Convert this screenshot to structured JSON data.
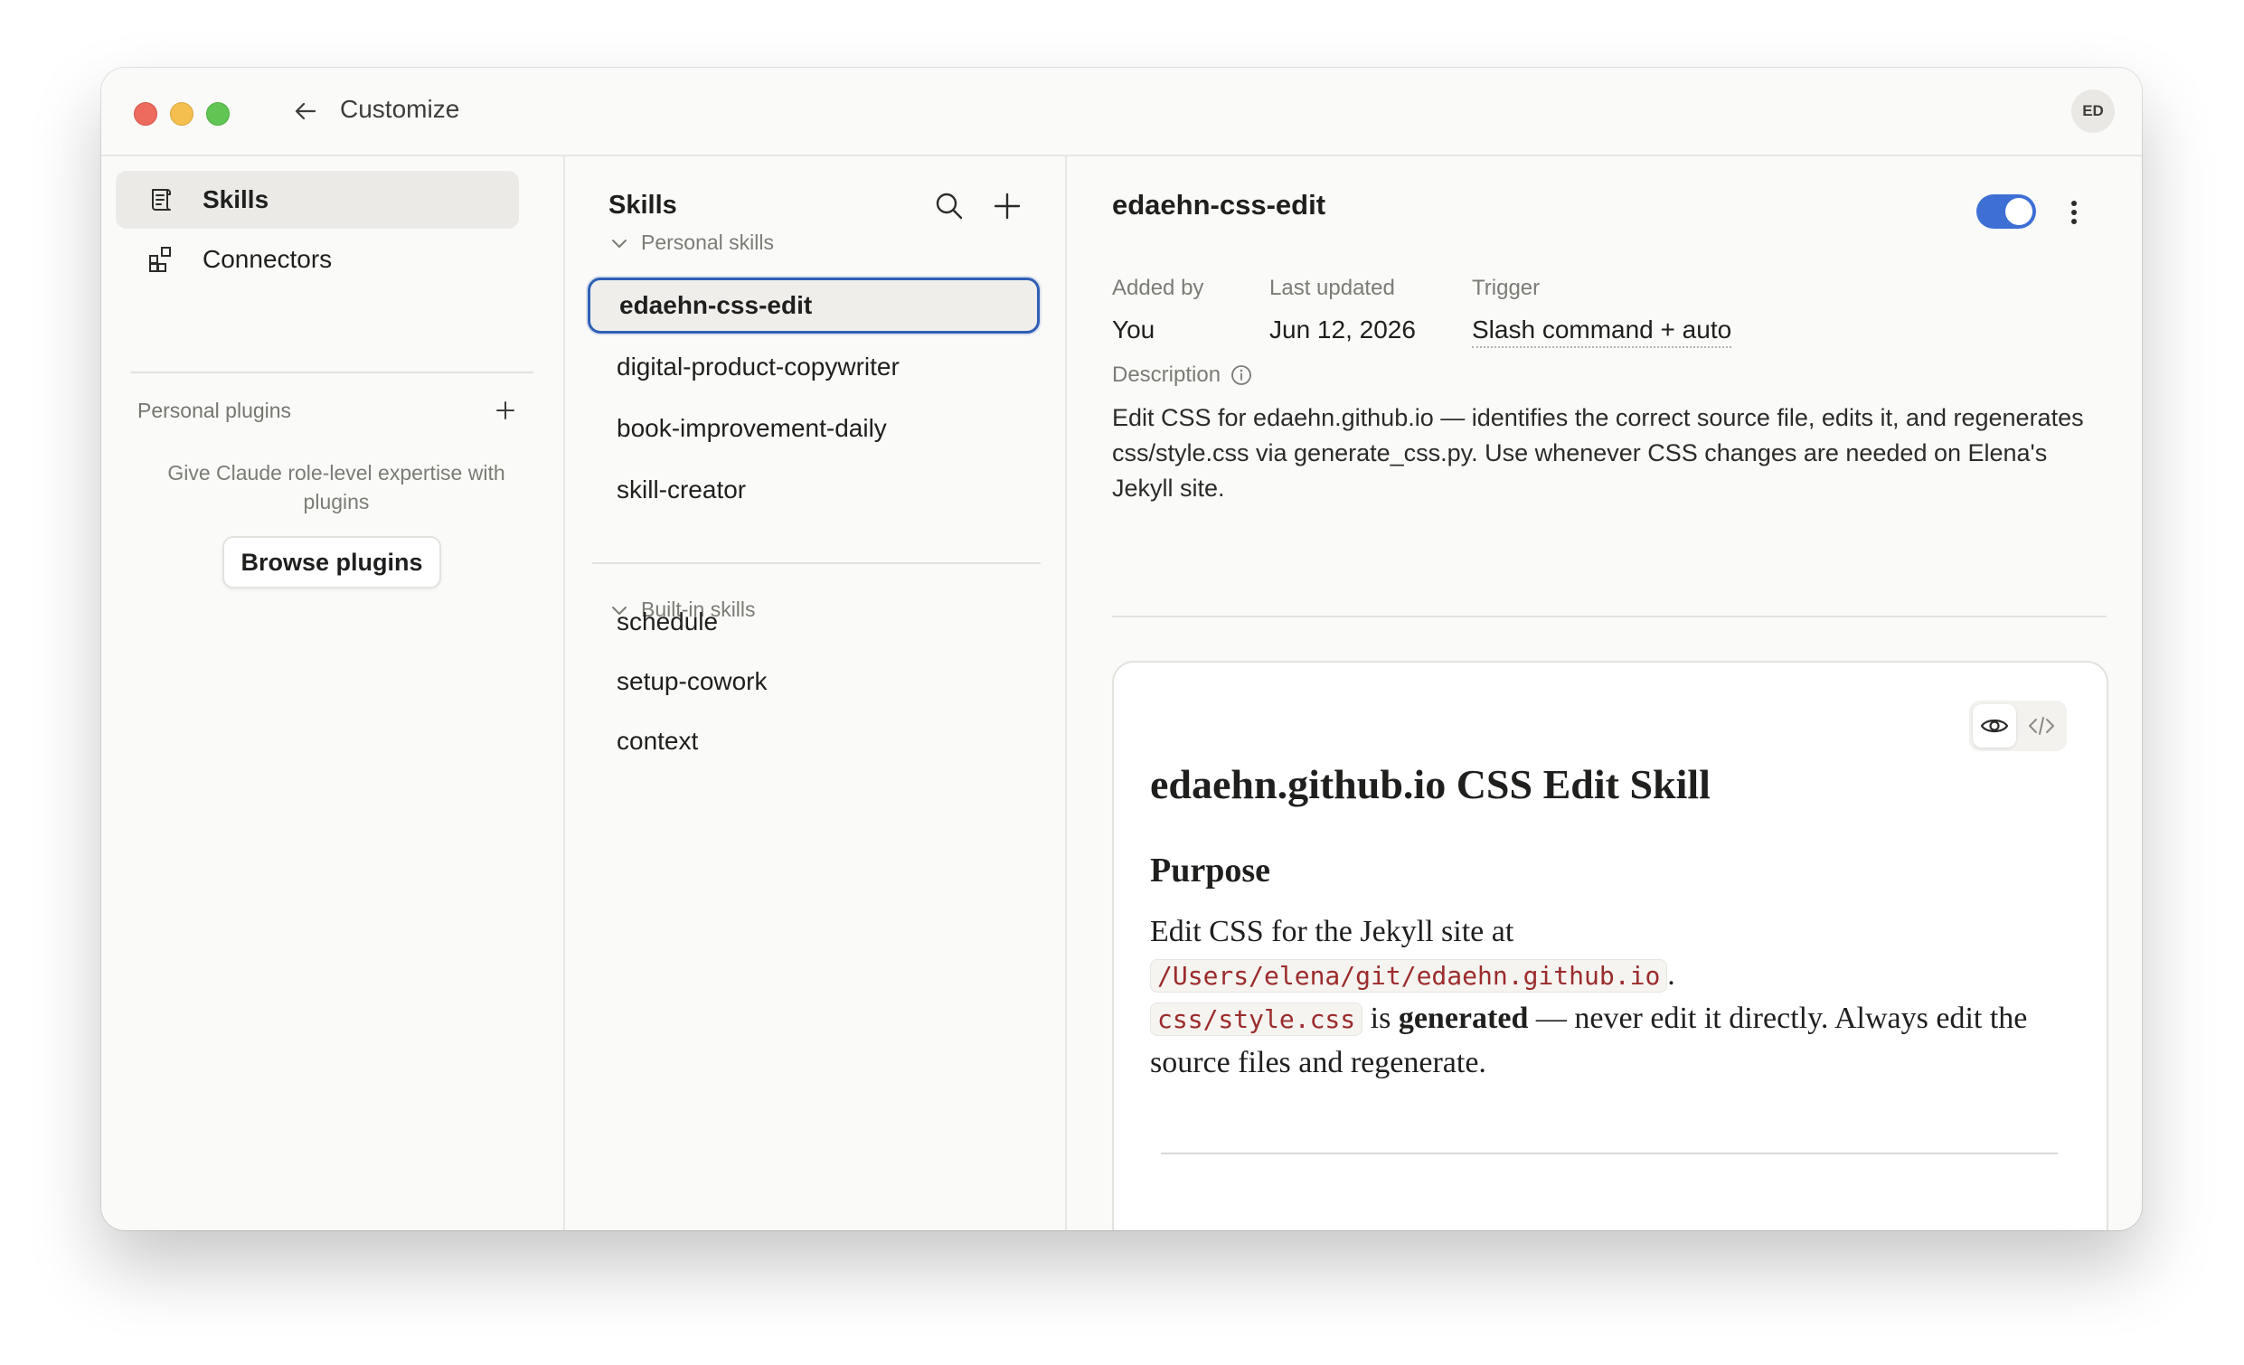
{
  "window": {
    "title": "Customize",
    "avatar_initials": "ED"
  },
  "nav": {
    "items": [
      {
        "label": "Skills",
        "icon": "scroll-icon",
        "active": true
      },
      {
        "label": "Connectors",
        "icon": "connectors-icon",
        "active": false
      }
    ],
    "plugins_heading": "Personal plugins",
    "plugins_hint": "Give Claude role-level expertise with plugins",
    "browse_label": "Browse plugins"
  },
  "skills_list": {
    "title": "Skills",
    "personal_heading": "Personal skills",
    "personal": [
      "edaehn-css-edit",
      "digital-product-copywriter",
      "book-improvement-daily",
      "skill-creator"
    ],
    "builtin_heading": "Built-in skills",
    "builtin": [
      "schedule",
      "setup-cowork",
      "context"
    ]
  },
  "detail": {
    "title": "edaehn-css-edit",
    "enabled": true,
    "added_by_label": "Added by",
    "added_by": "You",
    "updated_label": "Last updated",
    "updated": "Jun 12, 2026",
    "trigger_label": "Trigger",
    "trigger": "Slash command + auto",
    "description_label": "Description",
    "description": "Edit CSS for edaehn.github.io — identifies the correct source file, edits it, and regenerates css/style.css via generate_css.py. Use whenever CSS changes are needed on Elena's Jekyll site."
  },
  "preview": {
    "h1": "edaehn.github.io CSS Edit Skill",
    "h2": "Purpose",
    "p1_text": "Edit CSS for the Jekyll site at",
    "p1_code": "/Users/elena/git/edaehn.github.io",
    "p1_end": ".",
    "p2_code": "css/style.css",
    "p2_is": "is",
    "p2_bold": "generated",
    "p2_rest": "— never edit it directly. Always edit the source files and regenerate."
  },
  "colors": {
    "accent": "#3d6fd4",
    "selection_border": "#2f5fb5",
    "code_text": "#9b2c2c"
  }
}
